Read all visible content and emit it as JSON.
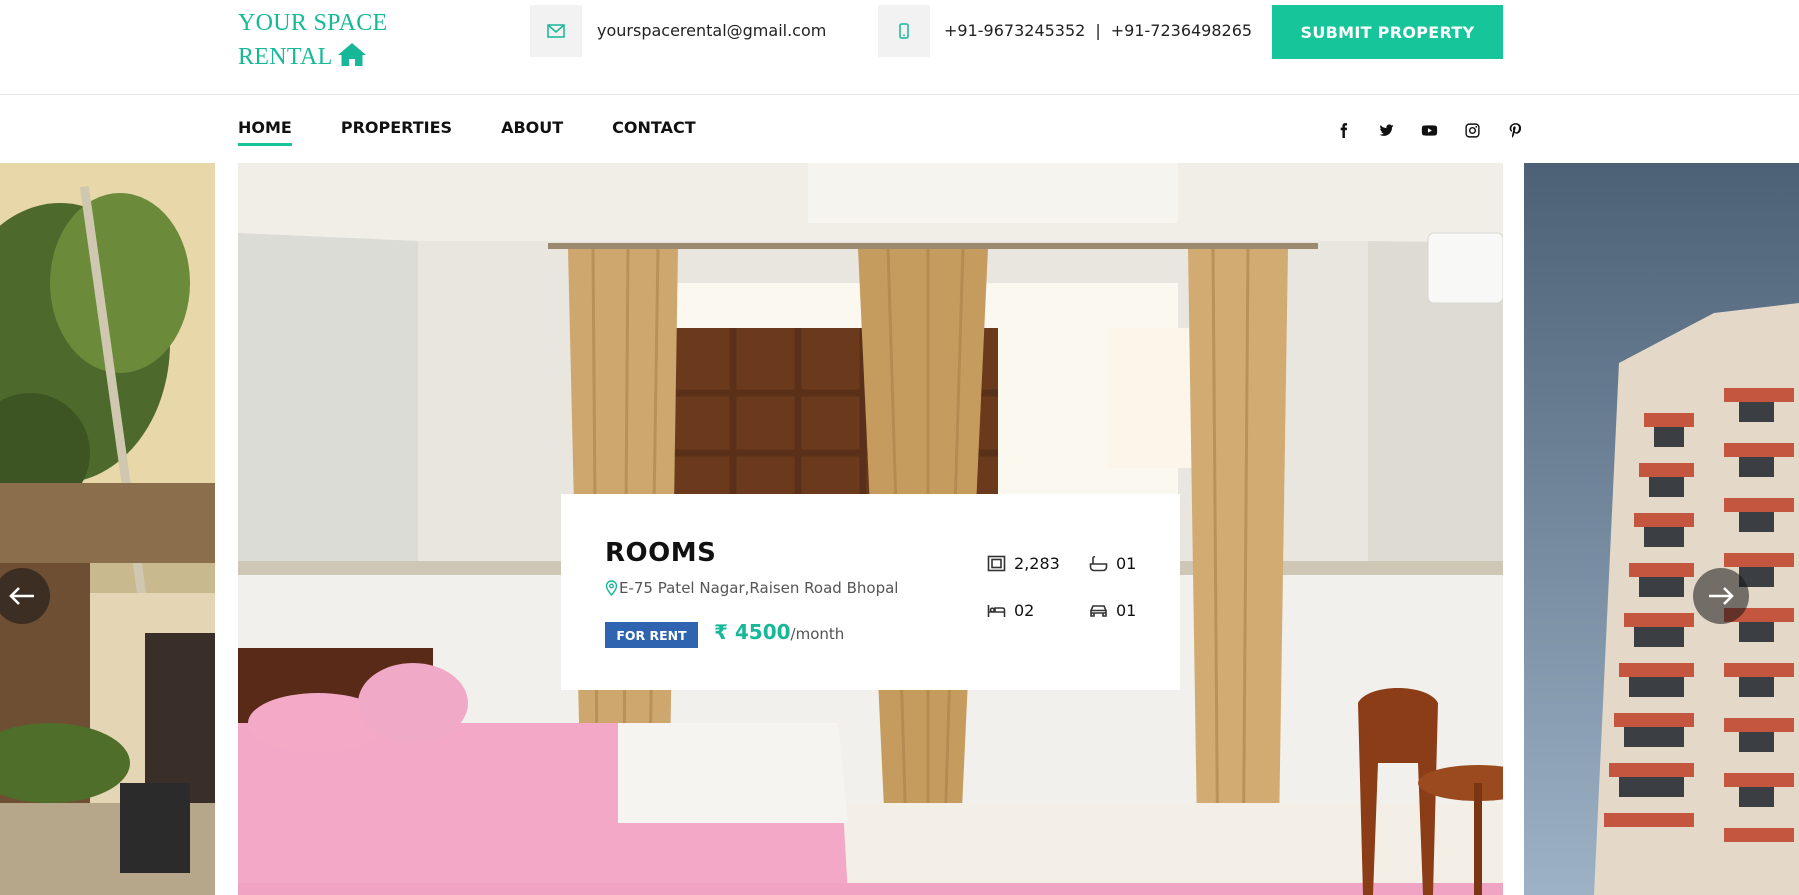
{
  "brand": {
    "line1": "YOUR SPACE",
    "line2": "RENTAL",
    "color": "#17b897"
  },
  "header": {
    "email": "yourspacerental@gmail.com",
    "phone1": "+91-9673245352",
    "phone_separator": "|",
    "phone2": "+91-7236498265",
    "submit_label": "SUBMIT PROPERTY",
    "accent": "#17c59b"
  },
  "nav": {
    "items": [
      {
        "label": "HOME",
        "active": true
      },
      {
        "label": "PROPERTIES",
        "active": false
      },
      {
        "label": "ABOUT",
        "active": false
      },
      {
        "label": "CONTACT",
        "active": false
      }
    ]
  },
  "social": [
    "facebook-icon",
    "twitter-icon",
    "youtube-icon",
    "instagram-icon",
    "pinterest-icon"
  ],
  "property": {
    "title": "ROOMS",
    "address": "E-75 Patel Nagar,Raisen Road Bhopal",
    "badge": "FOR RENT",
    "badge_color": "#2f64b0",
    "price": "₹ 4500",
    "price_period": "/month",
    "area": "2,283",
    "baths": "01",
    "beds": "02",
    "garage": "01"
  },
  "slider": {
    "prev_icon": "arrow-left-icon",
    "next_icon": "arrow-right-icon"
  }
}
